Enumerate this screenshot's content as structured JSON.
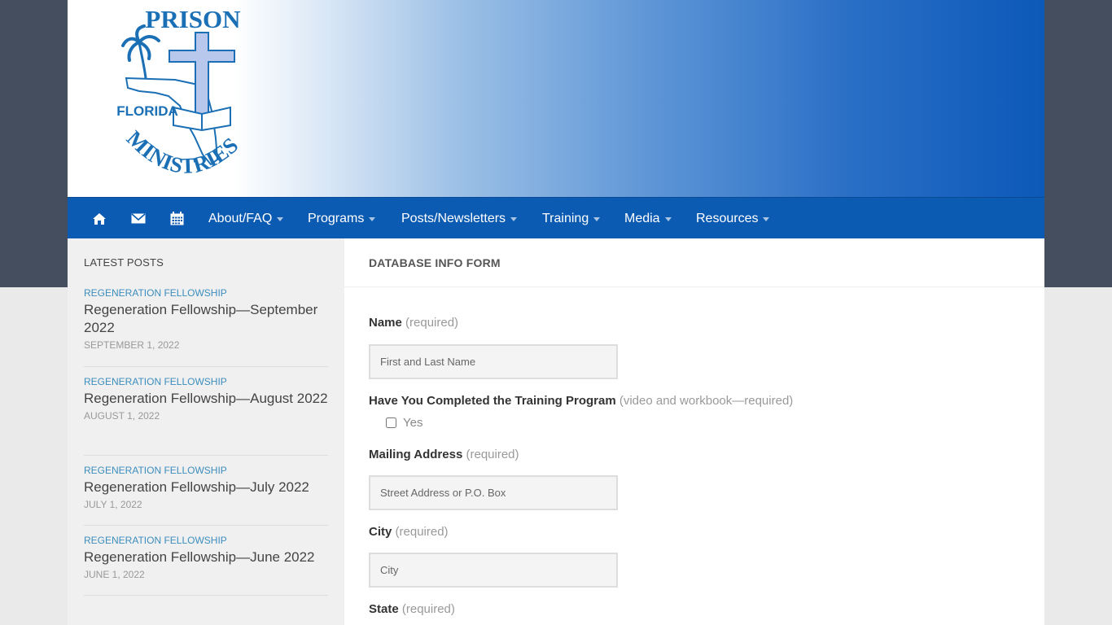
{
  "header": {
    "logo": {
      "text_top": "PRISON",
      "text_mid": "FLORIDA",
      "text_bottom": "MINISTRIES"
    }
  },
  "nav": {
    "icons": [
      "home-icon",
      "envelope-icon",
      "calendar-icon"
    ],
    "items": [
      {
        "label": "About/FAQ"
      },
      {
        "label": "Programs"
      },
      {
        "label": "Posts/Newsletters"
      },
      {
        "label": "Training"
      },
      {
        "label": "Media"
      },
      {
        "label": "Resources"
      }
    ]
  },
  "sidebar": {
    "title": "LATEST POSTS",
    "posts": [
      {
        "category": "REGENERATION FELLOWSHIP",
        "title": "Regeneration Fellowship—September 2022",
        "date": "SEPTEMBER 1, 2022"
      },
      {
        "category": "REGENERATION FELLOWSHIP",
        "title": "Regeneration Fellowship—August 2022",
        "date": "AUGUST 1, 2022"
      },
      {
        "category": "REGENERATION FELLOWSHIP",
        "title": "Regeneration Fellowship—July 2022",
        "date": "JULY 1, 2022"
      },
      {
        "category": "REGENERATION FELLOWSHIP",
        "title": "Regeneration Fellowship—June 2022",
        "date": "JUNE 1, 2022"
      }
    ]
  },
  "main": {
    "title": "DATABASE INFO FORM",
    "form": {
      "name": {
        "label": "Name",
        "req": "(required)",
        "placeholder": "First and Last Name",
        "value": ""
      },
      "training": {
        "label": "Have You Completed the Training Program",
        "req": "(video and workbook—required)",
        "option": "Yes",
        "checked": false
      },
      "address": {
        "label": "Mailing Address",
        "req": "(required)",
        "placeholder": "Street Address or P.O. Box",
        "value": ""
      },
      "city": {
        "label": "City",
        "req": "(required)",
        "placeholder": "City",
        "value": ""
      },
      "state": {
        "label": "State",
        "req": "(required)"
      }
    }
  },
  "colors": {
    "top_band": "#454e5e",
    "nav_bg": "#0c5bb2",
    "link_blue": "#3b8dbd",
    "logo_blue": "#1a6fb5"
  }
}
